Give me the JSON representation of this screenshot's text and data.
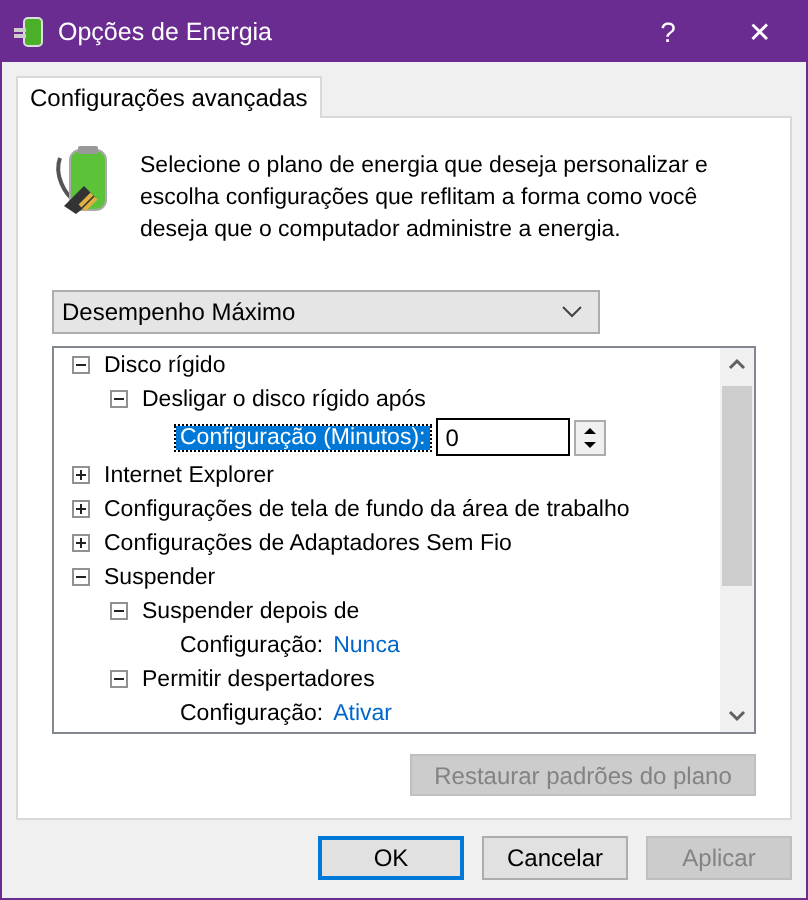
{
  "window": {
    "title": "Opções de Energia",
    "help": "?",
    "close": "✕"
  },
  "tabs": [
    {
      "label": "Configurações avançadas",
      "selected": true
    }
  ],
  "description": "Selecione o plano de energia que deseja personalizar e escolha configurações que reflitam a forma como você deseja que o computador administre a energia.",
  "plan_dropdown": {
    "value": "Desempenho Máximo"
  },
  "tree": [
    {
      "kind": "group",
      "label": "Disco rígido",
      "expanded": true,
      "children": [
        {
          "kind": "group",
          "label": "Desligar o disco rígido após",
          "expanded": true,
          "children": [
            {
              "kind": "spin",
              "label": "Configuração (Minutos):",
              "value": "0",
              "selected": true
            }
          ]
        }
      ]
    },
    {
      "kind": "group",
      "label": "Internet Explorer",
      "expanded": false
    },
    {
      "kind": "group",
      "label": "Configurações de tela de fundo da área de trabalho",
      "expanded": false
    },
    {
      "kind": "group",
      "label": "Configurações de Adaptadores Sem Fio",
      "expanded": false
    },
    {
      "kind": "group",
      "label": "Suspender",
      "expanded": true,
      "children": [
        {
          "kind": "group",
          "label": "Suspender depois de",
          "expanded": true,
          "children": [
            {
              "kind": "value",
              "label": "Configuração:",
              "value": "Nunca",
              "selected": false
            }
          ]
        },
        {
          "kind": "group",
          "label": "Permitir despertadores",
          "expanded": true,
          "children": [
            {
              "kind": "value",
              "label": "Configuração:",
              "value": "Ativar",
              "selected": false
            }
          ]
        }
      ]
    }
  ],
  "restore_button": {
    "label": "Restaurar padrões do plano",
    "disabled": true
  },
  "buttons": [
    {
      "label": "OK",
      "default": true,
      "disabled": false
    },
    {
      "label": "Cancelar",
      "default": false,
      "disabled": false
    },
    {
      "label": "Aplicar",
      "default": false,
      "disabled": true
    }
  ]
}
